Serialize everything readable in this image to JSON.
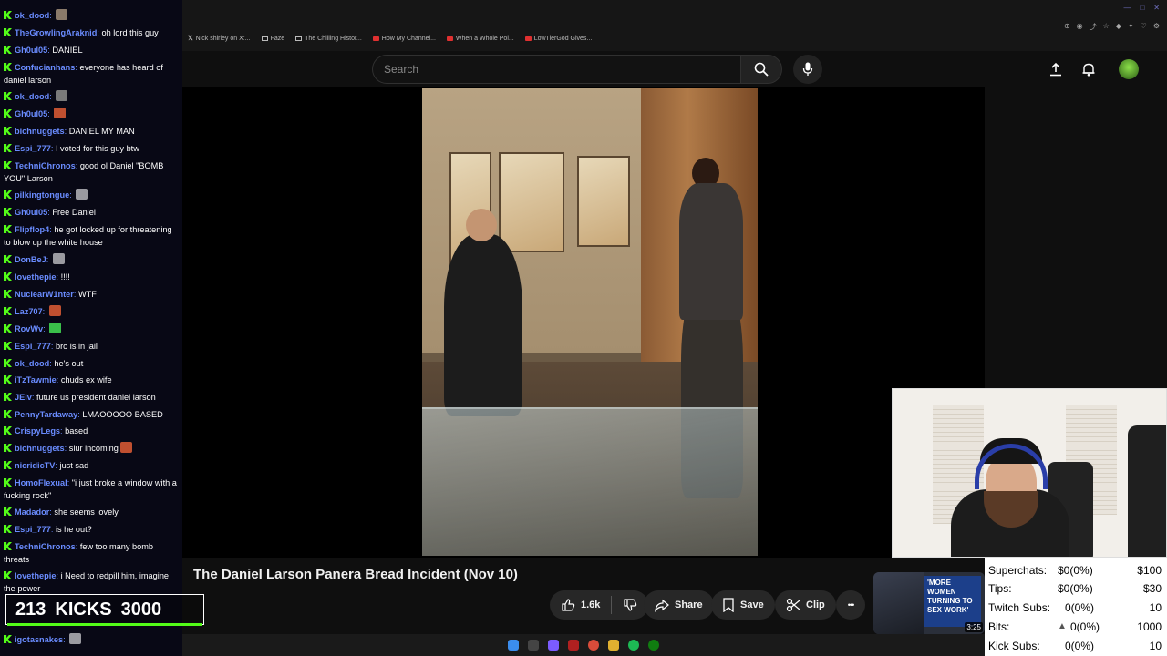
{
  "browser": {
    "bookmarks": [
      "Nick shirley on X:...",
      "Faze",
      "The Chilling Histor...",
      "How My Channel...",
      "When a Whole Pol...",
      "LowTierGod Gives..."
    ]
  },
  "youtube": {
    "search_placeholder": "Search",
    "video_title": "The Daniel Larson Panera Bread Incident (Nov 10)",
    "like_count": "1.6k",
    "share_label": "Share",
    "save_label": "Save",
    "clip_label": "Clip",
    "more_label": "•••",
    "related": {
      "headline": "'MORE WOMEN TURNING TO SEX WORK'",
      "duration": "3:25"
    }
  },
  "chat": [
    {
      "user": "ok_dood",
      "color": "#6a8cff",
      "text": "",
      "emote": "#8a7a6a"
    },
    {
      "user": "TheGrowlingAraknid",
      "color": "#6a8cff",
      "text": "oh lord this guy"
    },
    {
      "user": "Gh0ul05",
      "color": "#6a8cff",
      "text": "DANIEL"
    },
    {
      "user": "Confucianhans",
      "color": "#6a8cff",
      "text": "everyone has heard of daniel larson"
    },
    {
      "user": "ok_dood",
      "color": "#6a8cff",
      "text": "",
      "emote": "#7a7a7a"
    },
    {
      "user": "Gh0ul05",
      "color": "#6a8cff",
      "text": "",
      "emote": "#c05030"
    },
    {
      "user": "bichnuggets",
      "color": "#6a8cff",
      "text": "DANIEL MY MAN"
    },
    {
      "user": "Espi_777",
      "color": "#6a8cff",
      "text": "I voted for this guy btw"
    },
    {
      "user": "TechniChronos",
      "color": "#6a8cff",
      "text": "good ol Daniel \"BOMB YOU\" Larson"
    },
    {
      "user": "pilkingtongue",
      "color": "#6a8cff",
      "text": "",
      "emote": "#9a9aa0"
    },
    {
      "user": "Gh0ul05",
      "color": "#6a8cff",
      "text": "Free Daniel"
    },
    {
      "user": "Flipflop4",
      "color": "#6a8cff",
      "text": "he got locked up for threatening to blow up the white house"
    },
    {
      "user": "DonBeJ",
      "color": "#6a8cff",
      "text": "",
      "emote": "#9a9aa0"
    },
    {
      "user": "lovethepie",
      "color": "#6a8cff",
      "text": "!!!!"
    },
    {
      "user": "NuclearW1nter",
      "color": "#6a8cff",
      "text": "WTF"
    },
    {
      "user": "Laz707",
      "color": "#6a8cff",
      "text": "",
      "emote": "#c05030"
    },
    {
      "user": "RovWv",
      "color": "#6a8cff",
      "text": "",
      "emote": "#3ac04a"
    },
    {
      "user": "Espi_777",
      "color": "#6a8cff",
      "text": "bro is in jail"
    },
    {
      "user": "ok_dood",
      "color": "#6a8cff",
      "text": "he's out"
    },
    {
      "user": "iTzTawmie",
      "color": "#6a8cff",
      "text": "chuds ex wife"
    },
    {
      "user": "JElv",
      "color": "#6a8cff",
      "text": "future us president daniel larson"
    },
    {
      "user": "PennyTardaway",
      "color": "#6a8cff",
      "text": "LMAOOOOO BASED"
    },
    {
      "user": "CrispyLegs",
      "color": "#6a8cff",
      "text": "based"
    },
    {
      "user": "bichnuggets",
      "color": "#6a8cff",
      "text": "slur incoming",
      "emote": "#c05030"
    },
    {
      "user": "nicridicTV",
      "color": "#6a8cff",
      "text": "just sad"
    },
    {
      "user": "HomoFlexual",
      "color": "#6a8cff",
      "text": "\"i just broke a window with a fucking rock\""
    },
    {
      "user": "Madador",
      "color": "#6a8cff",
      "text": "she seems lovely"
    },
    {
      "user": "Espi_777",
      "color": "#6a8cff",
      "text": "is he out?"
    },
    {
      "user": "TechniChronos",
      "color": "#6a8cff",
      "text": "few too many bomb threats"
    },
    {
      "user": "lovethepie",
      "color": "#6a8cff",
      "text": "i Need to redpill him, imagine the power"
    },
    {
      "user": "igotasnakes",
      "color": "#6a8cff",
      "text": "",
      "emote": "#9a9aa0"
    }
  ],
  "kicks": {
    "count": "213",
    "label": "KICKS",
    "goal": "3000"
  },
  "stats": [
    {
      "label": "Superchats:",
      "value": "$0(0%)",
      "goal": "$100"
    },
    {
      "label": "Tips:",
      "value": "$0(0%)",
      "goal": "$30"
    },
    {
      "label": "Twitch Subs:",
      "value": "0(0%)",
      "goal": "10"
    },
    {
      "label": "Bits:",
      "value": "0(0%)",
      "goal": "1000"
    },
    {
      "label": "Kick Subs:",
      "value": "0(0%)",
      "goal": "10"
    }
  ]
}
